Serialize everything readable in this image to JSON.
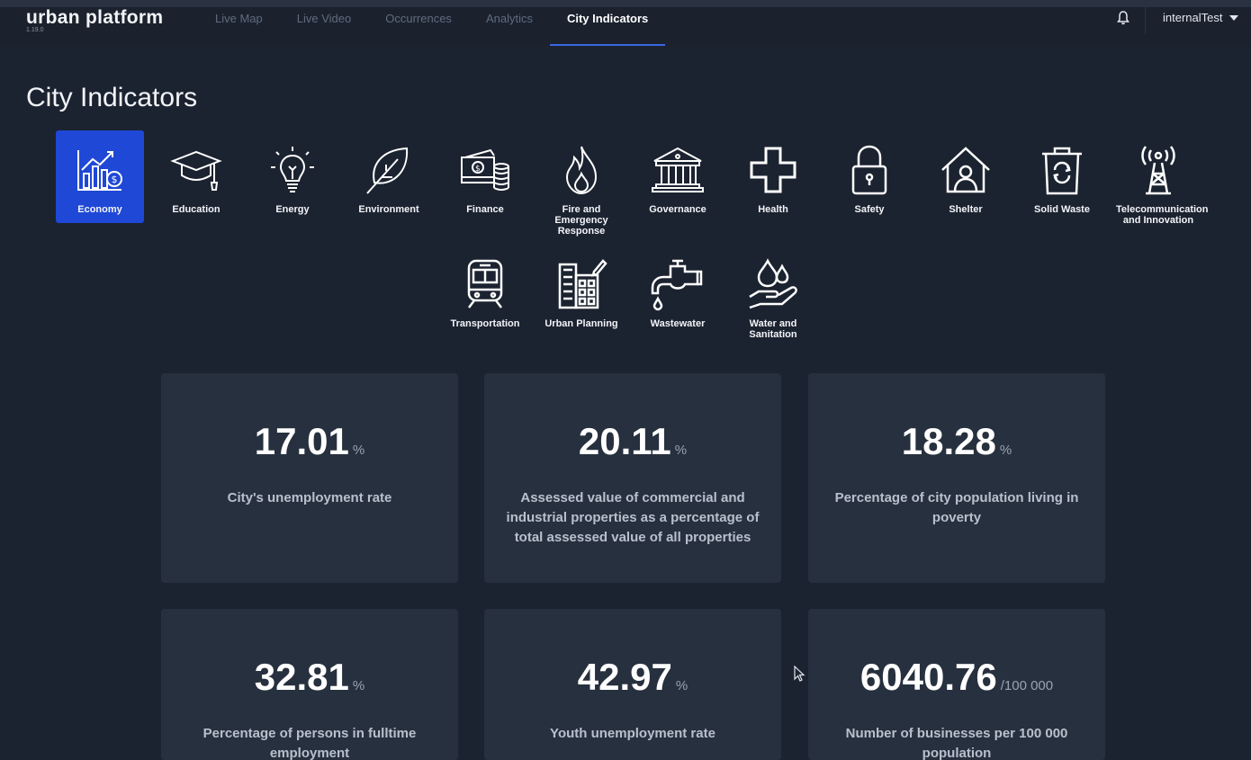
{
  "brand": {
    "name": "urban platform",
    "version": "1.19.0"
  },
  "nav": [
    {
      "label": "Live Map",
      "active": false
    },
    {
      "label": "Live Video",
      "active": false
    },
    {
      "label": "Occurrences",
      "active": false
    },
    {
      "label": "Analytics",
      "active": false
    },
    {
      "label": "City Indicators",
      "active": true
    }
  ],
  "user": {
    "name": "internalTest"
  },
  "page": {
    "title": "City Indicators"
  },
  "categories": [
    {
      "label": "Economy",
      "icon": "economy-chart-icon",
      "active": true
    },
    {
      "label": "Education",
      "icon": "graduation-cap-icon"
    },
    {
      "label": "Energy",
      "icon": "lightbulb-icon"
    },
    {
      "label": "Environment",
      "icon": "leaf-icon"
    },
    {
      "label": "Finance",
      "icon": "money-stack-icon"
    },
    {
      "label": "Fire and Emergency Response",
      "icon": "flame-icon"
    },
    {
      "label": "Governance",
      "icon": "government-building-icon"
    },
    {
      "label": "Health",
      "icon": "medical-cross-icon"
    },
    {
      "label": "Safety",
      "icon": "padlock-icon"
    },
    {
      "label": "Shelter",
      "icon": "house-person-icon"
    },
    {
      "label": "Solid Waste",
      "icon": "recycle-bin-icon"
    },
    {
      "label": "Telecommunication and Innovation",
      "icon": "antenna-tower-icon"
    },
    {
      "label": "Transportation",
      "icon": "train-icon"
    },
    {
      "label": "Urban Planning",
      "icon": "buildings-icon"
    },
    {
      "label": "Wastewater",
      "icon": "faucet-icon"
    },
    {
      "label": "Water and Sanitation",
      "icon": "hand-water-drop-icon"
    }
  ],
  "indicators": [
    {
      "value": "17.01",
      "unit": "%",
      "description": "City's unemployment rate"
    },
    {
      "value": "20.11",
      "unit": "%",
      "description": "Assessed value of commercial and industrial properties as a percentage of total assessed value of all properties"
    },
    {
      "value": "18.28",
      "unit": "%",
      "description": "Percentage of city population living in poverty"
    },
    {
      "value": "32.81",
      "unit": "%",
      "description": "Percentage of persons in fulltime employment"
    },
    {
      "value": "42.97",
      "unit": "%",
      "description": "Youth unemployment rate"
    },
    {
      "value": "6040.76",
      "unit": "/100 000",
      "description": "Number of businesses per 100 000 population"
    }
  ],
  "colors": {
    "background": "#1c2330",
    "card": "#27303e",
    "accent": "#1f48d6",
    "nav_underline": "#3b66e0"
  }
}
